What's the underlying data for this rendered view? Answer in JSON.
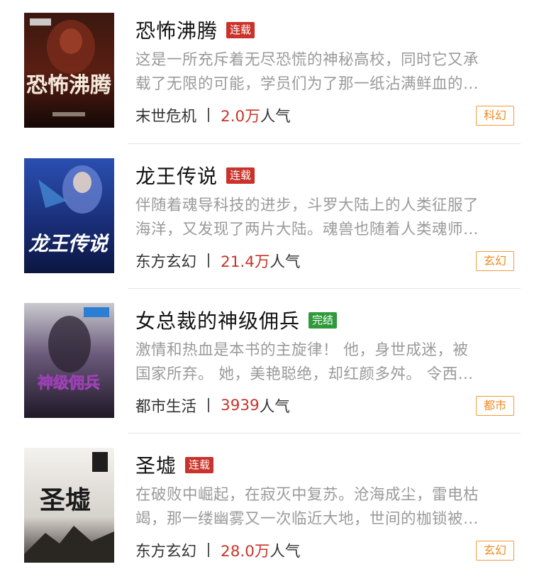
{
  "books": [
    {
      "title": "恐怖沸腾",
      "status": "连载",
      "status_color": "#c9332b",
      "desc_lines": [
        "这是一所充斥着无尽恐慌的神秘高校，同时它又承",
        "载了无限的可能，学员们为了那一纸沾满鲜血的…"
      ],
      "category": "末世危机",
      "popularity_num": "2.0万",
      "popularity_unit": "人气",
      "genre_tag": "科幻",
      "cover_title": "恐怖沸腾"
    },
    {
      "title": "龙王传说",
      "status": "连载",
      "status_color": "#c9332b",
      "desc_lines": [
        "伴随着魂导科技的进步，斗罗大陆上的人类征服了",
        "海洋，又发现了两片大陆。魂兽也随着人类魂师…"
      ],
      "category": "东方玄幻",
      "popularity_num": "21.4万",
      "popularity_unit": "人气",
      "genre_tag": "玄幻",
      "cover_title": "龙王传说"
    },
    {
      "title": "女总裁的神级佣兵",
      "status": "完结",
      "status_color": "#2e9a3a",
      "desc_lines": [
        "激情和热血是本书的主旋律！ 他，身世成迷，被",
        "国家所弃。 她，美艳聪绝，却红颜多舛。 令西…"
      ],
      "category": "都市生活",
      "popularity_num": "3939",
      "popularity_unit": "人气",
      "genre_tag": "都市",
      "cover_title": "神级佣兵"
    },
    {
      "title": "圣墟",
      "status": "连载",
      "status_color": "#c9332b",
      "desc_lines": [
        "在破败中崛起，在寂灭中复苏。沧海成尘，雷电枯",
        "竭，那一缕幽雾又一次临近大地，世间的枷锁被…"
      ],
      "category": "东方玄幻",
      "popularity_num": "28.0万",
      "popularity_unit": "人气",
      "genre_tag": "玄幻",
      "cover_title": "圣墟"
    }
  ]
}
